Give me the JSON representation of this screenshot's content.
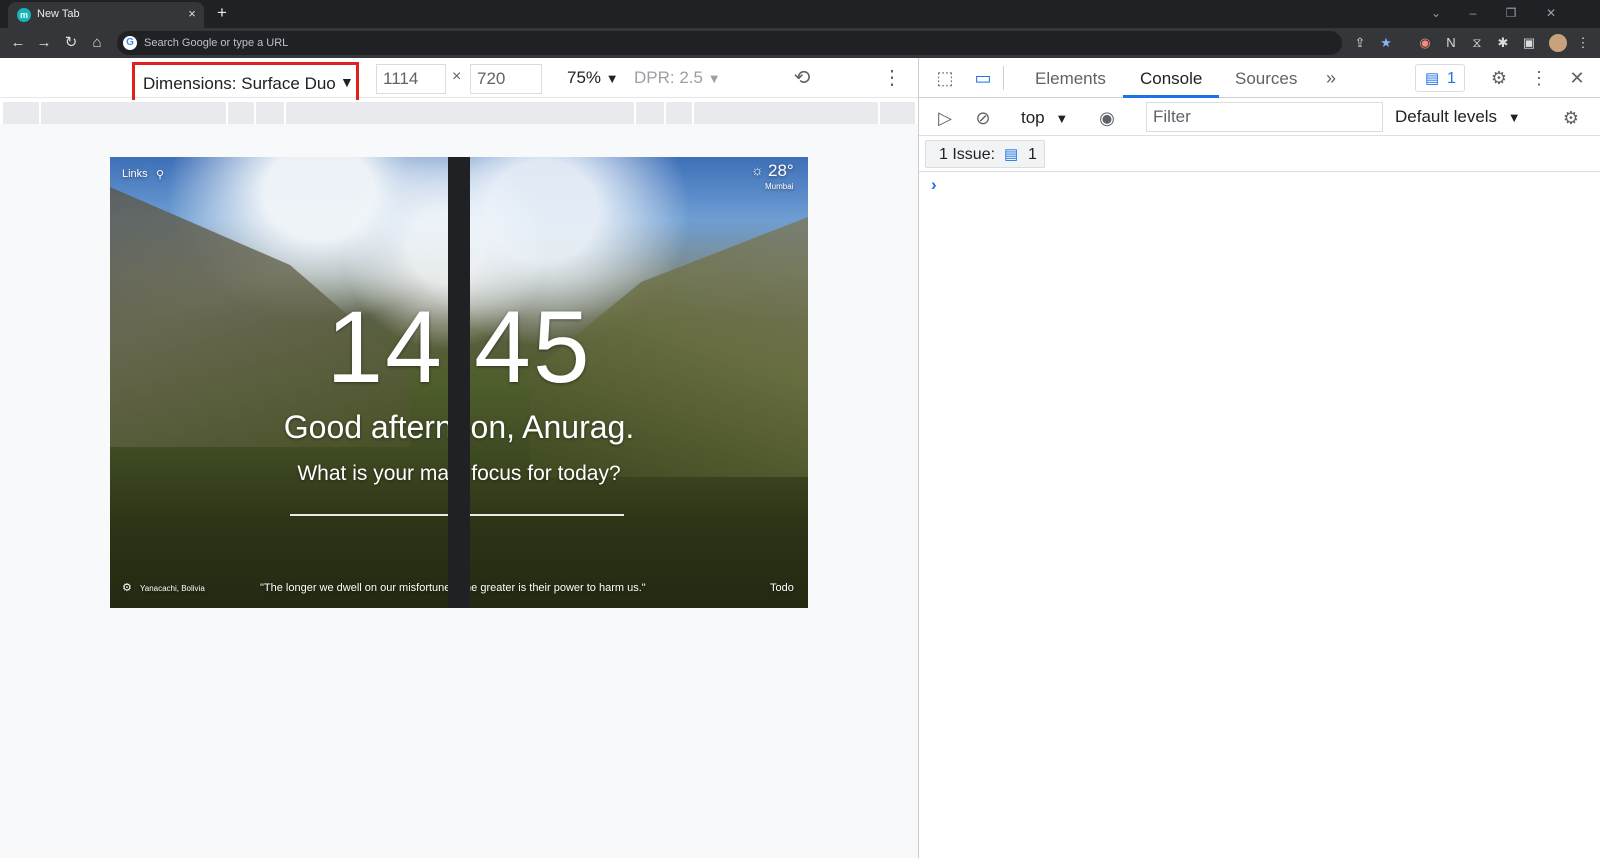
{
  "browser": {
    "tab": {
      "title": "New Tab",
      "favicon_letter": "m",
      "close_glyph": "×"
    },
    "new_tab_glyph": "+",
    "window_controls": {
      "dropdown": "⌄",
      "minimize": "–",
      "restore": "❐",
      "close": "✕"
    },
    "nav": {
      "back": "←",
      "forward": "→",
      "reload": "↻",
      "home": "⌂"
    },
    "omnibox": {
      "icon_letter": "G",
      "placeholder": "Search Google or type a URL"
    },
    "toolbar_icons": {
      "share": "⇪",
      "bookmark": "★",
      "ext1": "◉",
      "ext2": "N",
      "ext3": "⧖",
      "extensions": "✱",
      "side_panel": "▣",
      "menu": "⋮"
    }
  },
  "device_toolbar": {
    "dimensions_label": "Dimensions: Surface Duo",
    "dropdown_glyph": "▼",
    "width_value": "1114",
    "height_value": "720",
    "times_glyph": "×",
    "zoom_label": "75%",
    "dpr_label": "DPR: 2.5",
    "rotate_glyph": "⟲",
    "more_glyph": "⋮"
  },
  "emulated_page": {
    "links_label": "Links",
    "search_glyph": "⚲",
    "weather_glyph": "☼",
    "temperature": "28°",
    "city": "Mumbai",
    "clock": "14:45",
    "greeting": "Good afternoon, Anurag.",
    "question": "What is your main focus for today?",
    "gear_glyph": "⚙",
    "location": "Yanacachi, Bolivia",
    "quote": "\"The longer we dwell on our misfortunes, the greater is their power to harm us.\"",
    "todo_label": "Todo"
  },
  "devtools": {
    "inspect_glyph": "⬚",
    "device_glyph": "▭",
    "tabs": [
      "Elements",
      "Console",
      "Sources"
    ],
    "more_tabs_glyph": "»",
    "issues_badge_glyph": "▤",
    "issues_badge_count": "1",
    "settings_glyph": "⚙",
    "menu_glyph": "⋮",
    "close_glyph": "✕",
    "console": {
      "sidebar_glyph": "▷",
      "clear_glyph": "⊘",
      "context_label": "top",
      "dropdown_glyph": "▼",
      "eye_glyph": "◉",
      "filter_placeholder": "Filter",
      "levels_label": "Default levels",
      "settings_glyph": "⚙",
      "issues_label": "1 Issue:",
      "issues_glyph": "▤",
      "issues_count": "1",
      "prompt_glyph": "›"
    }
  },
  "colors": {
    "highlight_border": "#e0201c",
    "accent_blue": "#1a73e8",
    "chrome_dark": "#202124"
  }
}
